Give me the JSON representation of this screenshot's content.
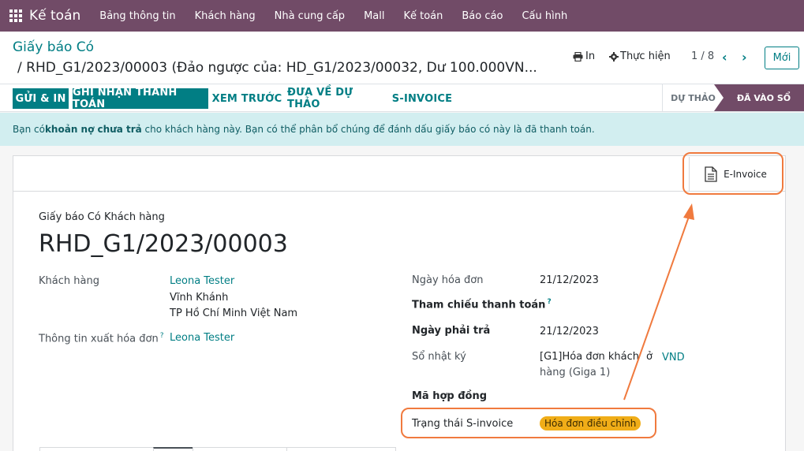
{
  "app": {
    "name": "Kế toán"
  },
  "menu": [
    "Bảng thông tin",
    "Khách hàng",
    "Nhà cung cấp",
    "Mall",
    "Kế toán",
    "Báo cáo",
    "Cấu hình"
  ],
  "breadcrumb": {
    "parent": "Giấy báo Có",
    "current": "/ RHD_G1/2023/00003 (Đảo ngược của: HD_G1/2023/00032, Dư 100.000VN..."
  },
  "actions": {
    "print": "In",
    "action": "Thực hiện"
  },
  "pager": {
    "value": "1 / 8"
  },
  "new_button": "Mới",
  "status_buttons": {
    "send_print": "GỬI & IN",
    "register_payment": "GHI NHẬN THANH TOÁN",
    "preview": "XEM TRƯỚC",
    "reset_draft": "ĐƯA VỀ DỰ THẢO",
    "s_invoice": "S-INVOICE"
  },
  "stages": {
    "draft": "DỰ THẢO",
    "posted": "ĐÃ VÀO SỔ"
  },
  "alert": {
    "prefix": "Bạn có ",
    "emphasis": "khoản nợ chưa trả",
    "suffix": " cho khách hàng này. Bạn có thể phân bổ chúng để đánh dấu giấy báo có này là đã thanh toán."
  },
  "smart_button": {
    "einvoice": "E-Invoice"
  },
  "form": {
    "doc_type": "Giấy báo Có Khách hàng",
    "name": "RHD_G1/2023/00003",
    "customer_label": "Khách hàng",
    "customer_name": "Leona Tester",
    "customer_address1": "Vĩnh Khánh",
    "customer_address2": "TP Hồ Chí Minh Việt Nam",
    "invoicing_info_label": "Thông tin xuất hóa đơn",
    "invoicing_info_value": "Leona Tester",
    "invoice_date_label": "Ngày hóa đơn",
    "invoice_date": "21/12/2023",
    "payment_ref_label": "Tham chiếu thanh toán",
    "due_date_label": "Ngày phải trả",
    "due_date": "21/12/2023",
    "journal_label": "Sổ nhật ký",
    "journal_line1": "[G1]Hóa đơn khách",
    "journal_line2": "hàng (Giga 1)",
    "journal_in": "ở",
    "currency": "VND",
    "contract_label": "Mã hợp đồng",
    "sinvoice_status_label": "Trạng thái S-invoice",
    "sinvoice_status": "Hóa đơn điều chỉnh",
    "help_mark": "?"
  },
  "colors": {
    "brand": "#714b67",
    "accent": "#017e84",
    "alert_bg": "#d2eef0",
    "badge": "#f0ad18",
    "annotation": "#f07a3e"
  }
}
